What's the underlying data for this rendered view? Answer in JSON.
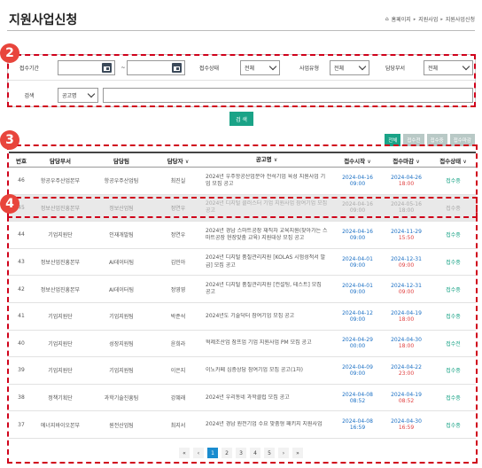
{
  "page": {
    "title": "지원사업신청"
  },
  "breadcrumb": [
    "홈페이지",
    "지원사업",
    "지원사업신청"
  ],
  "badges": [
    "2",
    "3",
    "4"
  ],
  "filter": {
    "period_label": "접수기간",
    "period_sep": "~",
    "status_label": "접수상태",
    "status_value": "전체",
    "type_label": "사업유형",
    "type_value": "전체",
    "dept_label": "담당부서",
    "dept_value": "전체",
    "search_label": "검색",
    "search_scope": "공고명"
  },
  "search_button": "검 색",
  "tabs": [
    {
      "label": "전체",
      "active": true
    },
    {
      "label": "접수전",
      "active": false
    },
    {
      "label": "접수중",
      "active": false
    },
    {
      "label": "접수마감",
      "active": false
    }
  ],
  "table": {
    "headers": [
      "번호",
      "담당부서",
      "담당팀",
      "담당자",
      "공고명",
      "접수시작",
      "접수마감",
      "접수상태"
    ],
    "sort_glyph": "∨",
    "rows": [
      {
        "no": "46",
        "dept": "항공우주산업본부",
        "team": "항공우주산업팀",
        "person": "최진실",
        "title": "2024년 우주항공산업분야 전석기업 육성 지원사업 기업 모집 공고",
        "start_date": "2024-04-16",
        "start_time": "09:00",
        "end_date": "2024-04-26",
        "end_time": "18:00",
        "status": "접수중"
      },
      {
        "no": "45",
        "dept": "정보산업진흥본부",
        "team": "정보산업팀",
        "person": "정연우",
        "title": "2024년 디지털 클러스터 기업 지원사업 참여기업 모집 공고",
        "start_date": "2024-04-16",
        "start_time": "09:00",
        "end_date": "2024-05-16",
        "end_time": "18:00",
        "status": "접수중"
      },
      {
        "no": "44",
        "dept": "기업지원단",
        "team": "인재개발팀",
        "person": "정연우",
        "title": "2024년 경남 스마트공장 재직자 교육지원(찾아가는 스마트공장 현장맞춤 교육) 지원대상 모집 공고",
        "start_date": "2024-04-16",
        "start_time": "09:00",
        "end_date": "2024-11-29",
        "end_time": "15:50",
        "status": "접수중"
      },
      {
        "no": "43",
        "dept": "정보산업진흥본부",
        "team": "AI데이터팀",
        "person": "김민아",
        "title": "2024년 디지털 품질관리지원 [KOLAS 시험성적서 발급] 모집 공고",
        "start_date": "2024-04-01",
        "start_time": "09:00",
        "end_date": "2024-12-31",
        "end_time": "09:00",
        "status": "접수중"
      },
      {
        "no": "42",
        "dept": "정보산업진흥본부",
        "team": "AI데이터팀",
        "person": "정영영",
        "title": "2024년 디지털 품질관리지원 [컨설팅, 테스트] 모집 공고",
        "start_date": "2024-04-01",
        "start_time": "09:00",
        "end_date": "2024-12-31",
        "end_time": "09:00",
        "status": "접수중"
      },
      {
        "no": "41",
        "dept": "기업지원단",
        "team": "기업지원팀",
        "person": "박준석",
        "title": "2024년도 기술닥터 참여기업 모집 공고",
        "start_date": "2024-04-12",
        "start_time": "09:00",
        "end_date": "2024-04-19",
        "end_time": "18:00",
        "status": "접수중"
      },
      {
        "no": "40",
        "dept": "기업지원단",
        "team": "성장지원팀",
        "person": "윤희라",
        "title": "혁제조산업 참프업 기업 지원사업 PM 모집 공고",
        "start_date": "2024-04-29",
        "start_time": "00:00",
        "end_date": "2024-04-30",
        "end_time": "18:00",
        "status": "접수전"
      },
      {
        "no": "39",
        "dept": "기업지원단",
        "team": "기업지원팀",
        "person": "이은지",
        "title": "이노카페 심층상담 참여기업 모집 공고(1차)",
        "start_date": "2024-04-09",
        "start_time": "09:00",
        "end_date": "2024-04-22",
        "end_time": "23:00",
        "status": "접수중"
      },
      {
        "no": "38",
        "dept": "정책기획단",
        "team": "과학기술진흥팀",
        "person": "강혜래",
        "title": "2024년 우리동네 과학클럽 모집 공고",
        "start_date": "2024-04-08",
        "start_time": "08:52",
        "end_date": "2024-04-19",
        "end_time": "08:52",
        "status": "접수중"
      },
      {
        "no": "37",
        "dept": "에너지바이오본부",
        "team": "원전산업팀",
        "person": "최지서",
        "title": "2024년 경남 원전기업 수요 맞춤형 패키지 지원사업",
        "start_date": "2024-04-08",
        "start_time": "16:59",
        "end_date": "2024-04-30",
        "end_time": "16:59",
        "status": "접수중"
      }
    ]
  },
  "pagination": {
    "first": "«",
    "prev": "‹",
    "pages": [
      "1",
      "2",
      "3",
      "4",
      "5"
    ],
    "current": "1",
    "next": "›",
    "last": "»"
  }
}
